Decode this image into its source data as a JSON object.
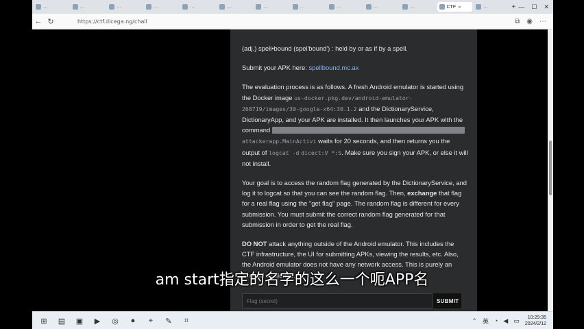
{
  "browser": {
    "tabs": [
      {
        "label": "…"
      },
      {
        "label": "…"
      },
      {
        "label": "…"
      },
      {
        "label": "…"
      },
      {
        "label": "…"
      },
      {
        "label": "…"
      },
      {
        "label": "…"
      },
      {
        "label": "…"
      },
      {
        "label": "…"
      },
      {
        "label": "…"
      },
      {
        "label": "…"
      },
      {
        "label": "CTF",
        "active": true
      },
      {
        "label": "…"
      }
    ],
    "close_glyph": "×",
    "new_tab_glyph": "+",
    "url": "https://ctf.dicega.ng/chall"
  },
  "challenge": {
    "definition": "(adj.) spell•bound (spel'bound') : held by or as if by a spell.",
    "submit_apk_prefix": "Submit your APK here:",
    "submit_apk_link": "spellbound.mc.ax",
    "eval_1": "The evaluation process is as follows. A fresh Android emulator is started using the Docker image",
    "eval_image": "us-docker.pkg.dev/android-emulator-268719/images/30-google-x64:30.1.2",
    "eval_2": "and the DictionaryService, DictionaryApp, and your APK are installed. It then launches your APK with the command",
    "eval_cmd_tail": "attackerapp.MainActivi",
    "eval_3": "waits for 20 seconds, and then returns you the output of",
    "eval_logcat": "logcat -d",
    "eval_filter": "dicect:V *:S",
    "eval_4": ". Make sure you sign your APK, or else it will not install.",
    "goal_1": "Your goal is to access the random flag generated by the DictionaryService, and log it to logcat so that you can see the random flag. Then,",
    "goal_exchange": "exchange",
    "goal_2": "that flag for a real flag using the \"get flag\" page. The random flag is different for every submission. You must submit the correct random flag generated for that submission in order to get the real flag.",
    "warn_strong": "DO NOT",
    "warn_text": "attack anything outside of the Android emulator. This includes the CTF infrastructure, the UI for submitting APKs, viewing the results, etc. Also, the Android emulator does not have any network access. This is purely an Android challenge.",
    "flag_placeholder": "Flag (secret)",
    "submit_button": "SUBMIT"
  },
  "overlay_subtitle": "am start指定的名字的这么一个呃APP名",
  "taskbar": {
    "icons": [
      "start-icon",
      "files-icon",
      "folder-icon",
      "terminal-icon",
      "chrome-icon",
      "app-icon",
      "pin-icon",
      "pen-icon",
      "crop-icon"
    ],
    "ime": "英",
    "time": "10:29:35",
    "date": "2024/2/12"
  }
}
